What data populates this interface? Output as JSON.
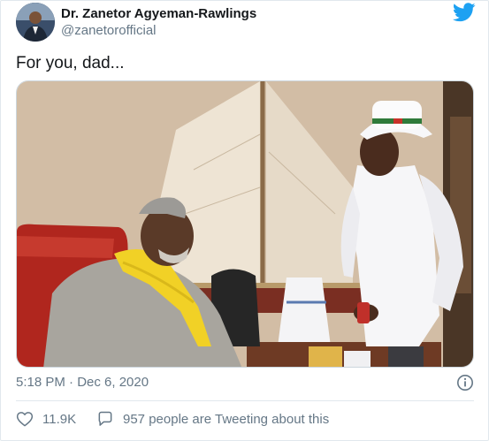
{
  "author": {
    "display_name": "Dr. Zanetor Agyeman-Rawlings",
    "handle": "@zanetorofficial"
  },
  "tweet": {
    "text": "For you, dad..."
  },
  "meta": {
    "timestamp": "5:18 PM · Dec 6, 2020"
  },
  "actions": {
    "likes": "11.9K",
    "tweeting": "957 people are Tweeting about this"
  },
  "colors": {
    "twitter_blue": "#1da1f2",
    "secondary_text": "#657786"
  },
  "icons": {
    "brand": "twitter-bird-icon",
    "info": "info-icon",
    "like": "heart-icon",
    "reply": "speech-bubble-icon"
  }
}
